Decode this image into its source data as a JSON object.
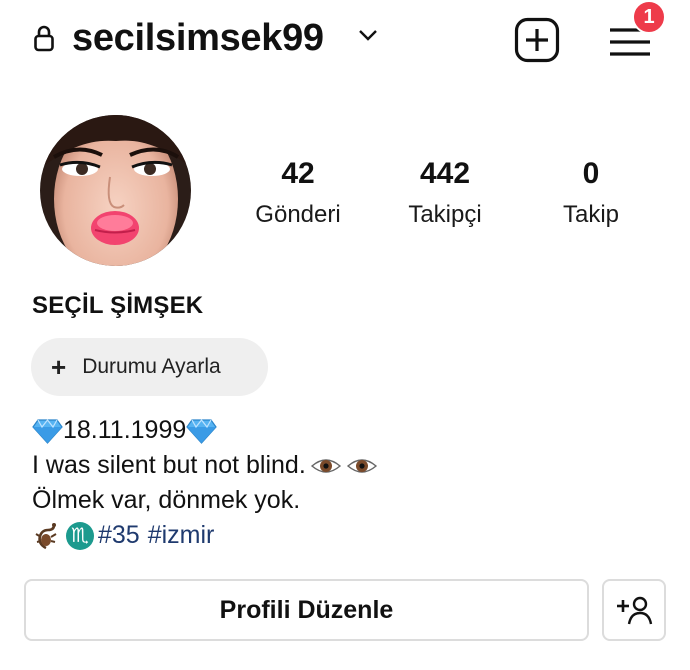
{
  "header": {
    "username": "secilsimsek99",
    "notification_count": "1",
    "icons": {
      "lock": "lock-icon",
      "chevron": "chevron-down-icon",
      "create": "plus-square-icon",
      "menu": "hamburger-menu-icon"
    }
  },
  "profile": {
    "full_name": "SEÇİL ŞİMŞEK",
    "stats": [
      {
        "value": "42",
        "label": "Gönderi"
      },
      {
        "value": "442",
        "label": "Takipçi"
      },
      {
        "value": "0",
        "label": "Takip"
      }
    ],
    "status_button": {
      "plus": "+",
      "label": "Durumu Ayarla"
    },
    "bio": {
      "line1": "18.11.1999",
      "line2": "I was silent but not blind.",
      "line3": "Ölmek var, dönmek yok.",
      "line4_tag1": "#35",
      "line4_tag2": "#izmir",
      "zodiac_symbol": "♏"
    }
  },
  "actions": {
    "edit_profile_label": "Profili Düzenle",
    "add_user_icon": "add-person-icon"
  },
  "colors": {
    "badge": "#ee3b4a",
    "pill_bg": "#efefef",
    "hashtag": "#1f3a6e",
    "border": "#dcdcdc",
    "gem": "#3aa0ea",
    "zodiac": "#1c9a8e"
  }
}
